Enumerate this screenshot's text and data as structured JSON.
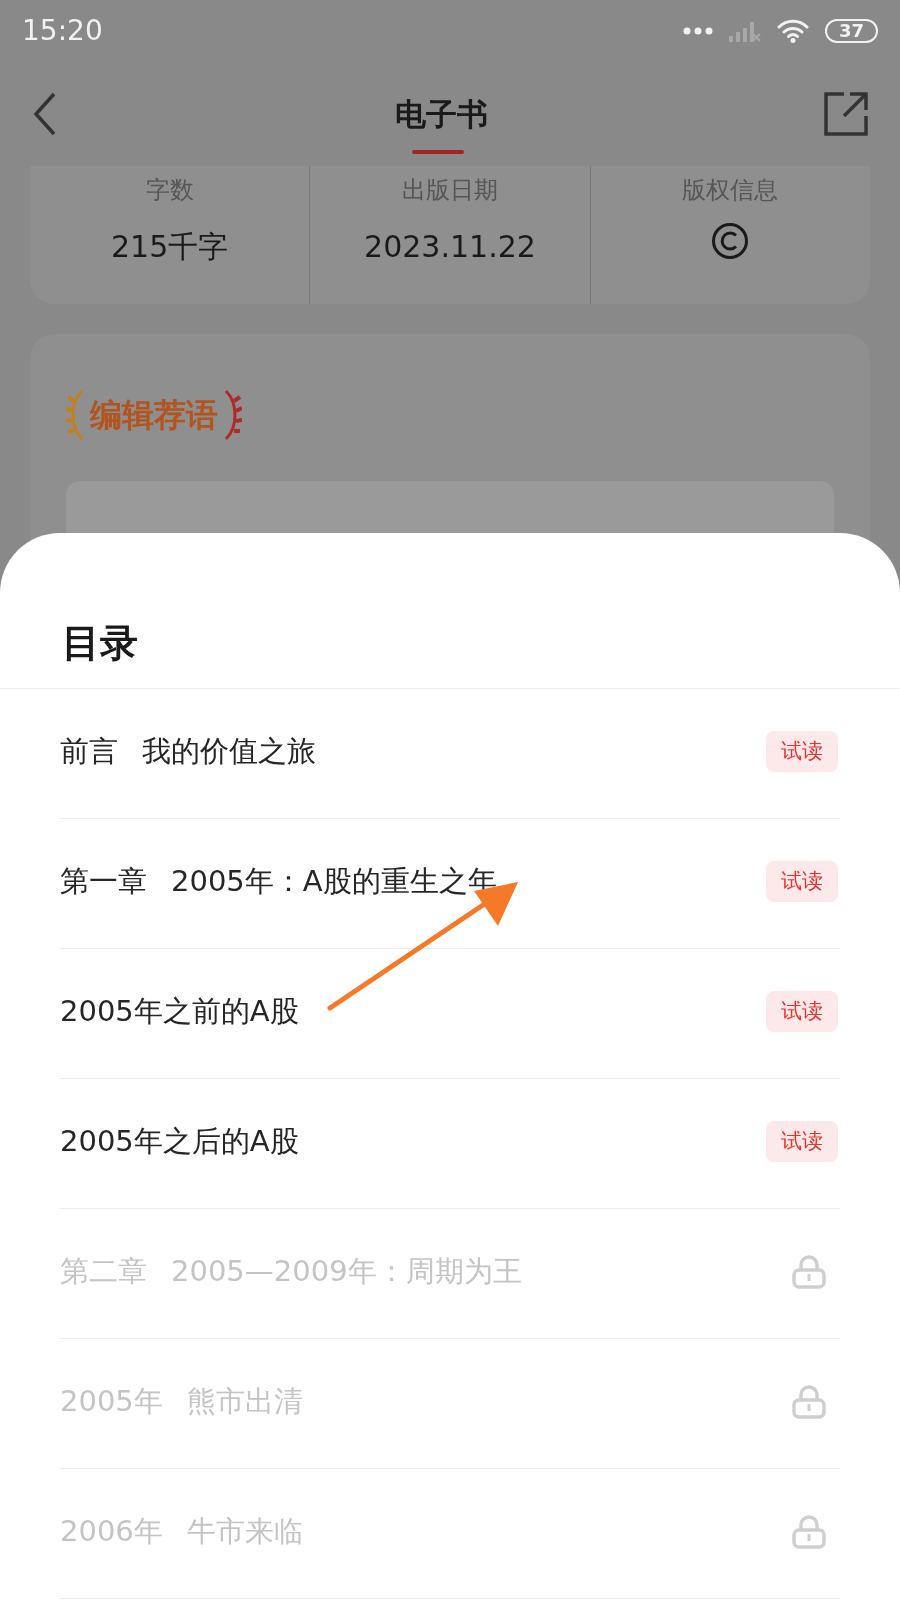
{
  "status_bar": {
    "time": "15:20",
    "battery": "37"
  },
  "header": {
    "title": "电子书",
    "selected": true
  },
  "info": [
    {
      "label": "字数",
      "value": "215千字",
      "kind": "text"
    },
    {
      "label": "出版日期",
      "value": "2023.11.22",
      "kind": "text"
    },
    {
      "label": "版权信息",
      "kind": "copyright"
    }
  ],
  "editor_card": {
    "heading": "编辑荐语"
  },
  "sheet": {
    "title": "目录",
    "items": [
      {
        "parts": [
          "前言",
          "我的价值之旅"
        ],
        "locked": false,
        "badge": "试读"
      },
      {
        "parts": [
          "第一章",
          "2005年：A股的重生之年"
        ],
        "locked": false,
        "badge": "试读"
      },
      {
        "parts": [
          "2005年之前的A股"
        ],
        "locked": false,
        "badge": "试读"
      },
      {
        "parts": [
          "2005年之后的A股"
        ],
        "locked": false,
        "badge": "试读"
      },
      {
        "parts": [
          "第二章",
          "2005—2009年：周期为王"
        ],
        "locked": true
      },
      {
        "parts": [
          "2005年",
          "熊市出清"
        ],
        "locked": true
      },
      {
        "parts": [
          "2006年",
          "牛市来临"
        ],
        "locked": true
      }
    ]
  }
}
